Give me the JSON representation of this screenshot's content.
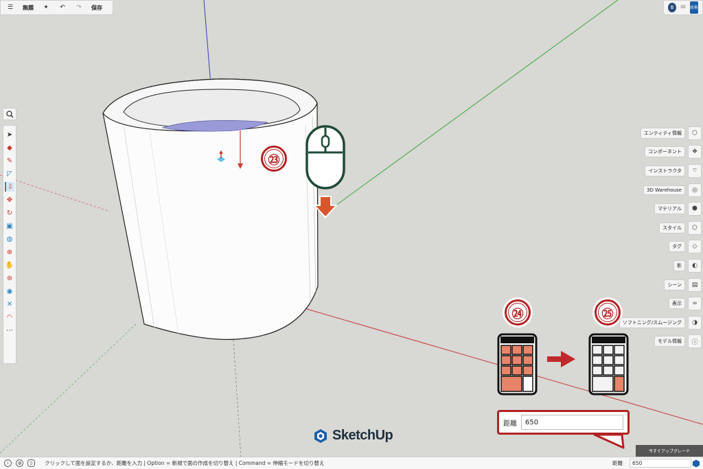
{
  "toolbar": {
    "menu_icon": "hamburger-icon",
    "file_name": "無題",
    "undo_icon": "undo-icon",
    "redo_icon": "redo-icon",
    "save_label": "保存"
  },
  "account": {
    "avatar_initial": "B",
    "share_label": "共有"
  },
  "right_panels": [
    {
      "label": "エンティティ情報",
      "icon": "entity-info-icon",
      "glyph": "⬡"
    },
    {
      "label": "コンポーネント",
      "icon": "components-icon",
      "glyph": "❖"
    },
    {
      "label": "インストラクタ",
      "icon": "instructor-icon",
      "glyph": "⌔"
    },
    {
      "label": "3D Warehouse",
      "icon": "warehouse-icon",
      "glyph": "◎"
    },
    {
      "label": "マテリアル",
      "icon": "materials-icon",
      "glyph": "⬢"
    },
    {
      "label": "スタイル",
      "icon": "styles-icon",
      "glyph": "⬡"
    },
    {
      "label": "タグ",
      "icon": "tags-icon",
      "glyph": "◇"
    },
    {
      "label": "影",
      "icon": "shadows-icon",
      "glyph": "◐"
    },
    {
      "label": "シーン",
      "icon": "scenes-icon",
      "glyph": "▤"
    },
    {
      "label": "表示",
      "icon": "display-icon",
      "glyph": "∞"
    },
    {
      "label": "ソフトニング/スムージング",
      "icon": "soften-icon",
      "glyph": "◑"
    },
    {
      "label": "モデル情報",
      "icon": "model-info-icon",
      "glyph": "ⓘ"
    }
  ],
  "annotations": {
    "step_a": "㉓",
    "step_b": "㉔",
    "step_c": "㉕"
  },
  "distance_box": {
    "label": "距離",
    "value": "650"
  },
  "brand": {
    "name": "SketchUp"
  },
  "upgrade_label": "今すぐアップグレード",
  "status": {
    "message": "クリックして面を設定するか、距離を入力 | Option = 新規で面の作成を切り替え | Command = 伸縮モードを切り替え",
    "distance_label": "距離",
    "distance_value": "650"
  }
}
